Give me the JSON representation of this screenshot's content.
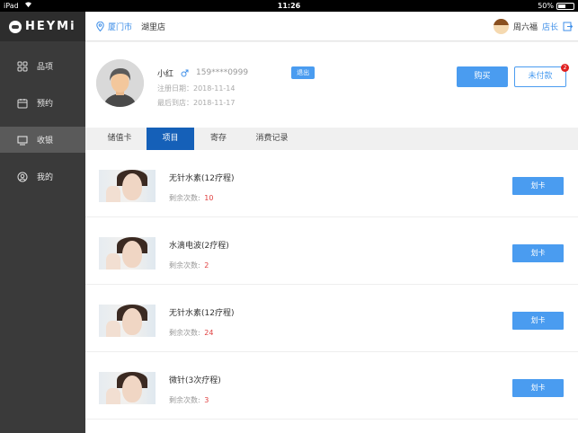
{
  "status_bar": {
    "device": "iPad",
    "time": "11:26",
    "battery": "50%"
  },
  "sidebar": {
    "logo_text": "HEYMi",
    "items": [
      {
        "label": "品项",
        "icon": "grid-icon"
      },
      {
        "label": "预约",
        "icon": "calendar-icon"
      },
      {
        "label": "收银",
        "icon": "monitor-icon",
        "active": true
      },
      {
        "label": "我的",
        "icon": "user-icon"
      }
    ]
  },
  "header": {
    "city": "厦门市",
    "store": "湖里店",
    "user_name": "周六福",
    "user_role": "店长"
  },
  "member": {
    "name": "小红",
    "phone": "159****0999",
    "logout_label": "退出",
    "register_date": "注册日期：2018-11-14",
    "last_visit": "最后到店：2018-11-17",
    "buy_label": "购买",
    "unpaid_label": "未付款",
    "unpaid_count": "2"
  },
  "tabs": [
    {
      "label": "储值卡"
    },
    {
      "label": "项目",
      "active": true
    },
    {
      "label": "寄存"
    },
    {
      "label": "消费记录"
    }
  ],
  "items": [
    {
      "name": "无针水素(12疗程)",
      "remain_label": "剩余次数:",
      "remain_count": "10",
      "button": "划卡"
    },
    {
      "name": "水滴电波(2疗程)",
      "remain_label": "剩余次数:",
      "remain_count": "2",
      "button": "划卡"
    },
    {
      "name": "无针水素(12疗程)",
      "remain_label": "剩余次数:",
      "remain_count": "24",
      "button": "划卡"
    },
    {
      "name": "微针(3次疗程)",
      "remain_label": "剩余次数:",
      "remain_count": "3",
      "button": "划卡"
    }
  ],
  "colors": {
    "accent": "#4a9cf0",
    "tab_active": "#1560b8",
    "sidebar": "#3a3a3a",
    "count": "#e04040"
  }
}
